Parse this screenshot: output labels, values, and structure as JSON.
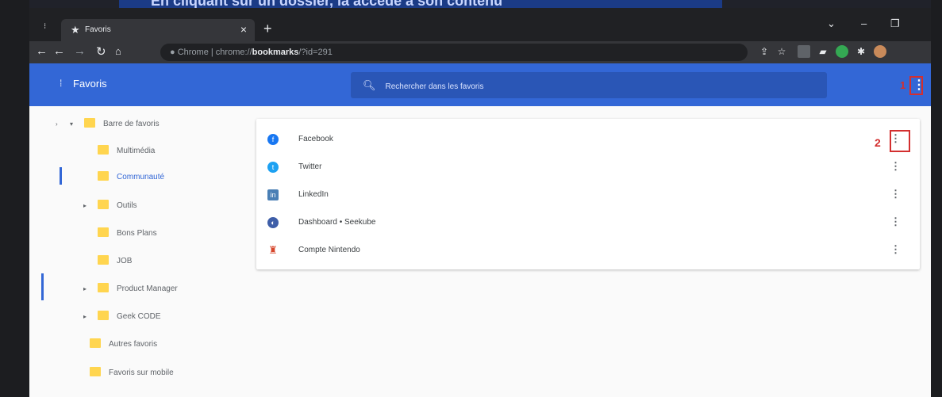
{
  "top_caption": "En cliquant sur un dossier, la accède à son contenu",
  "browser": {
    "tab_title": "Favoris",
    "tab_close": "×",
    "new_tab": "+",
    "url_prefix": "Chrome | chrome://",
    "url_bold": "bookmarks",
    "url_suffix": "/?id=291",
    "win_minimize": "–",
    "win_restore": "❐",
    "win_dropdown": "⌄"
  },
  "header": {
    "menu_glyph": "⁞",
    "title": "Favoris",
    "search_placeholder": "Rechercher dans les favoris",
    "more_glyph": "⋮",
    "annotation_1": "1"
  },
  "tree": [
    {
      "label": "Barre de favoris",
      "indent": 0,
      "expander": "▾",
      "selected": false
    },
    {
      "label": "Multimédia",
      "indent": 1,
      "expander": "",
      "selected": false
    },
    {
      "label": "Communauté",
      "indent": 1,
      "expander": "",
      "selected": true
    },
    {
      "label": "Outils",
      "indent": 1,
      "expander": "▸",
      "selected": false
    },
    {
      "label": "Bons Plans",
      "indent": 1,
      "expander": "",
      "selected": false
    },
    {
      "label": "JOB",
      "indent": 1,
      "expander": "",
      "selected": false
    },
    {
      "label": "Product Manager",
      "indent": 1,
      "expander": "▸",
      "selected": false
    },
    {
      "label": "Geek CODE",
      "indent": 1,
      "expander": "▸",
      "selected": false
    },
    {
      "label": "Autres favoris",
      "indent": 0,
      "expander": "",
      "selected": false
    },
    {
      "label": "Favoris sur mobile",
      "indent": 0,
      "expander": "",
      "selected": false
    }
  ],
  "bookmarks": [
    {
      "name": "Facebook",
      "icon": "facebook-icon",
      "color": "#1877f2",
      "glyph": "f"
    },
    {
      "name": "Twitter",
      "icon": "twitter-icon",
      "color": "#1da1f2",
      "glyph": "t"
    },
    {
      "name": "LinkedIn",
      "icon": "linkedin-icon",
      "color": "#4a7fb5",
      "glyph": "in"
    },
    {
      "name": "Dashboard • Seekube",
      "icon": "seekube-icon",
      "color": "#3e5ea8",
      "glyph": "◐"
    },
    {
      "name": "Compte Nintendo",
      "icon": "nintendo-icon",
      "color": "#d6462b",
      "glyph": "♜"
    }
  ],
  "row_more_glyph": "⋮",
  "annotation_2": "2"
}
